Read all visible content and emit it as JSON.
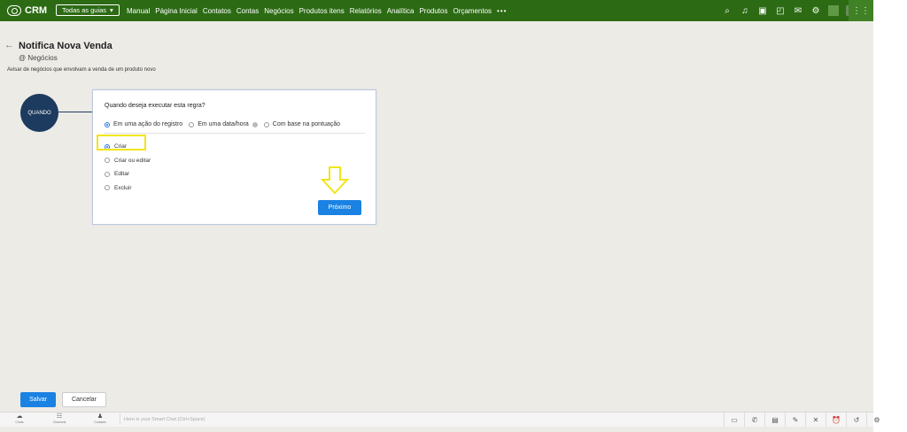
{
  "topbar": {
    "app_name": "CRM",
    "tabs_button": "Todas as guias",
    "nav": [
      "Manual",
      "Página Inicial",
      "Contatos",
      "Contas",
      "Negócios",
      "Produtos itens",
      "Relatórios",
      "Analítica",
      "Produtos",
      "Orçamentos"
    ],
    "more": "•••",
    "icons": [
      "search-icon",
      "bell-icon",
      "calendar-add-icon",
      "screen-icon",
      "mail-icon",
      "gear-icon"
    ],
    "grid_icon": "apps-grid-icon"
  },
  "header": {
    "title": "Notifica Nova Venda",
    "module": "@ Negócios",
    "description": "Avisar de negócios que envolvam a venda de um produto novo"
  },
  "flow": {
    "node_label": "QUANDO"
  },
  "card": {
    "question": "Quando deseja executar esta regra?",
    "trigger_options": [
      "Em uma ação do registro",
      "Em uma data/hora",
      "Com base na pontuação"
    ],
    "selected_trigger": "Em uma ação do registro",
    "actions": [
      "Criar",
      "Criar ou editar",
      "Editar",
      "Excluir"
    ],
    "selected_action": "Criar",
    "next_button": "Próximo"
  },
  "footer": {
    "save": "Salvar",
    "cancel": "Cancelar"
  },
  "bottombar": {
    "items": [
      "Chats",
      "Channels",
      "Contacts"
    ],
    "smart_chat_placeholder": "Here is your Smart Chat (Ctrl+Space)"
  },
  "colors": {
    "topbar": "#2c6b14",
    "primary": "#1a82e2",
    "node": "#1d3a5f",
    "highlight": "#f2e51b"
  }
}
